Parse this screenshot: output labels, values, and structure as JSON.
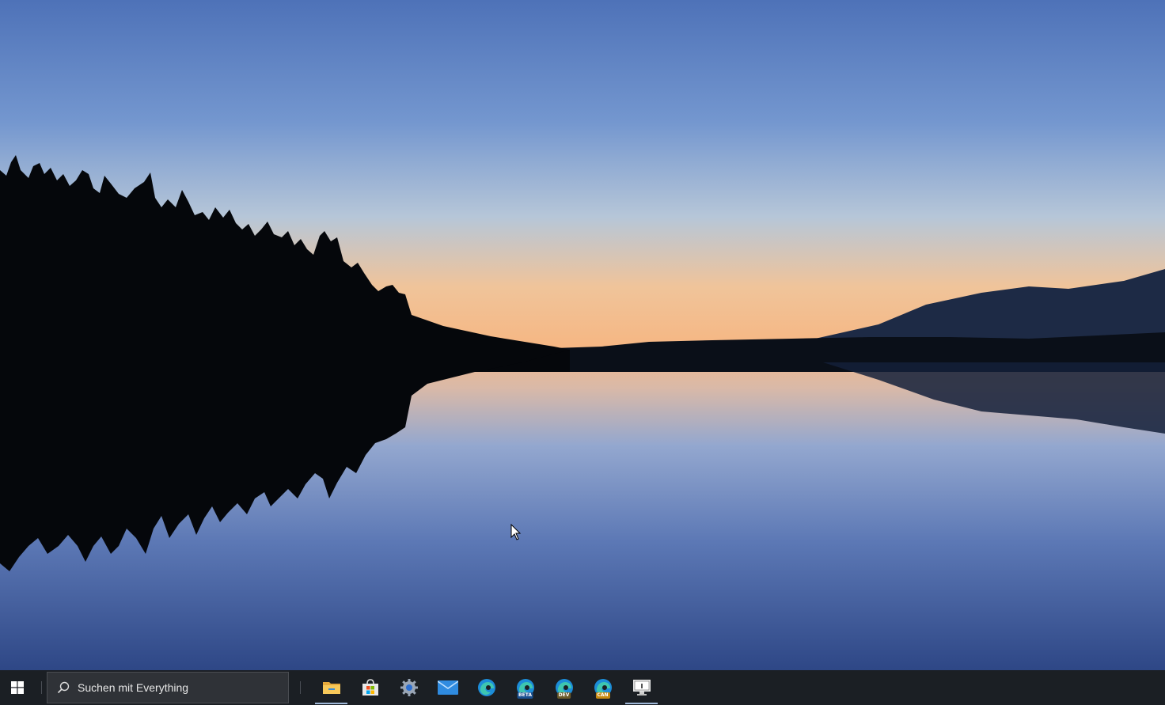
{
  "search": {
    "placeholder": "Suchen mit Everything"
  },
  "taskbar": {
    "apps": [
      {
        "name": "File Explorer",
        "icon": "folder-icon"
      },
      {
        "name": "Microsoft Store",
        "icon": "store-icon"
      },
      {
        "name": "Settings",
        "icon": "gear-icon"
      },
      {
        "name": "Mail",
        "icon": "mail-icon"
      },
      {
        "name": "Microsoft Edge",
        "icon": "edge-icon"
      },
      {
        "name": "Microsoft Edge Beta",
        "icon": "edge-beta-icon",
        "badge": "BETA"
      },
      {
        "name": "Microsoft Edge Dev",
        "icon": "edge-dev-icon",
        "badge": "DEV"
      },
      {
        "name": "Microsoft Edge Canary",
        "icon": "edge-canary-icon",
        "badge": "CAN"
      },
      {
        "name": "Remote Desktop",
        "icon": "remote-desktop-icon"
      }
    ]
  },
  "colors": {
    "taskbar_bg": "#1b1f24",
    "sky_top": "#4f73b9",
    "horizon": "#f7b985",
    "water_bottom": "#2f4987"
  }
}
